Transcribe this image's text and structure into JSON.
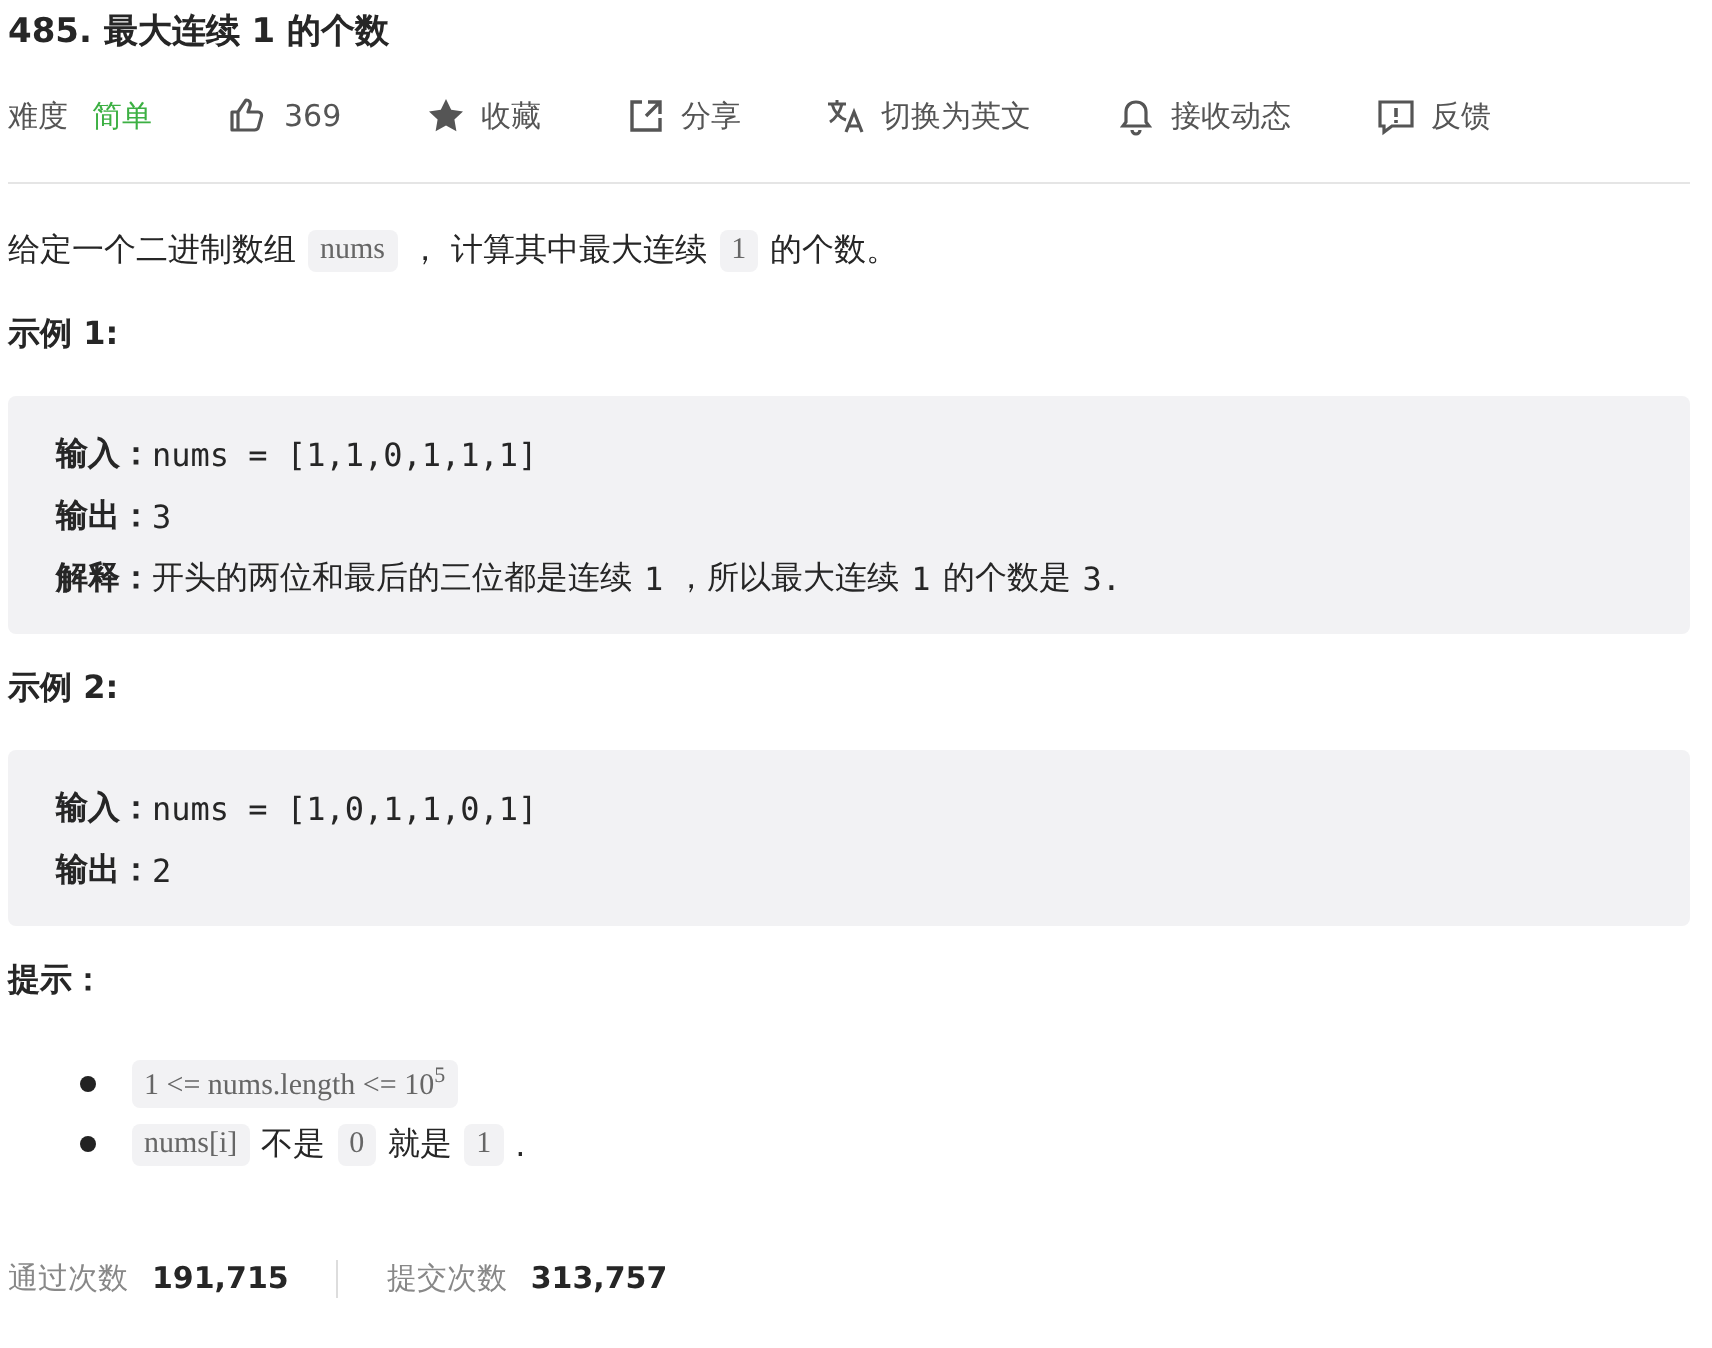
{
  "title": "485. 最大连续 1 的个数",
  "toolbar": {
    "difficulty_label": "难度",
    "difficulty": "简单",
    "actions": [
      {
        "kind": "like",
        "label": "369"
      },
      {
        "kind": "star",
        "label": "收藏"
      },
      {
        "kind": "share",
        "label": "分享"
      },
      {
        "kind": "translate",
        "label": "切换为英文"
      },
      {
        "kind": "bell",
        "label": "接收动态"
      },
      {
        "kind": "feedback",
        "label": "反馈"
      }
    ]
  },
  "description": [
    {
      "kind": "text",
      "text": "给定一个二进制数组"
    },
    {
      "kind": "code",
      "text": "nums"
    },
    {
      "kind": "text",
      "text": "， 计算其中最大连续"
    },
    {
      "kind": "code",
      "text": "1"
    },
    {
      "kind": "text",
      "text": "的个数。"
    }
  ],
  "examples": [
    {
      "heading": "示例 1:",
      "lines": [
        {
          "label": "输入：",
          "segments": [
            {
              "kind": "mono",
              "text": "nums = [1,1,0,1,1,1]"
            }
          ]
        },
        {
          "label": "输出：",
          "segments": [
            {
              "kind": "mono",
              "text": "3"
            }
          ]
        },
        {
          "label": "解释：",
          "segments": [
            {
              "kind": "text",
              "text": "开头的两位和最后的三位都是连续"
            },
            {
              "kind": "mono",
              "text": "1"
            },
            {
              "kind": "text",
              "text": "，所以最大连续"
            },
            {
              "kind": "mono",
              "text": "1"
            },
            {
              "kind": "text",
              "text": "的个数是"
            },
            {
              "kind": "mono",
              "text": "3."
            }
          ]
        }
      ]
    },
    {
      "heading": "示例 2:",
      "lines": [
        {
          "label": "输入：",
          "segments": [
            {
              "kind": "mono",
              "text": "nums = [1,0,1,1,0,1]"
            }
          ]
        },
        {
          "label": "输出：",
          "segments": [
            {
              "kind": "mono",
              "text": "2"
            }
          ]
        }
      ]
    }
  ],
  "hints": {
    "heading": "提示：",
    "items": [
      [
        {
          "kind": "code",
          "text": "1 <= nums.length <= 10$^{5}$"
        }
      ],
      [
        {
          "kind": "code",
          "text": "nums[i]"
        },
        {
          "kind": "text",
          "text": "不是"
        },
        {
          "kind": "code",
          "text": "0"
        },
        {
          "kind": "text",
          "text": "就是"
        },
        {
          "kind": "code",
          "text": "1"
        },
        {
          "kind": "text",
          "text": "."
        }
      ]
    ]
  },
  "stats": [
    {
      "label": "通过次数",
      "value": "191,715"
    },
    {
      "label": "提交次数",
      "value": "313,757"
    }
  ]
}
